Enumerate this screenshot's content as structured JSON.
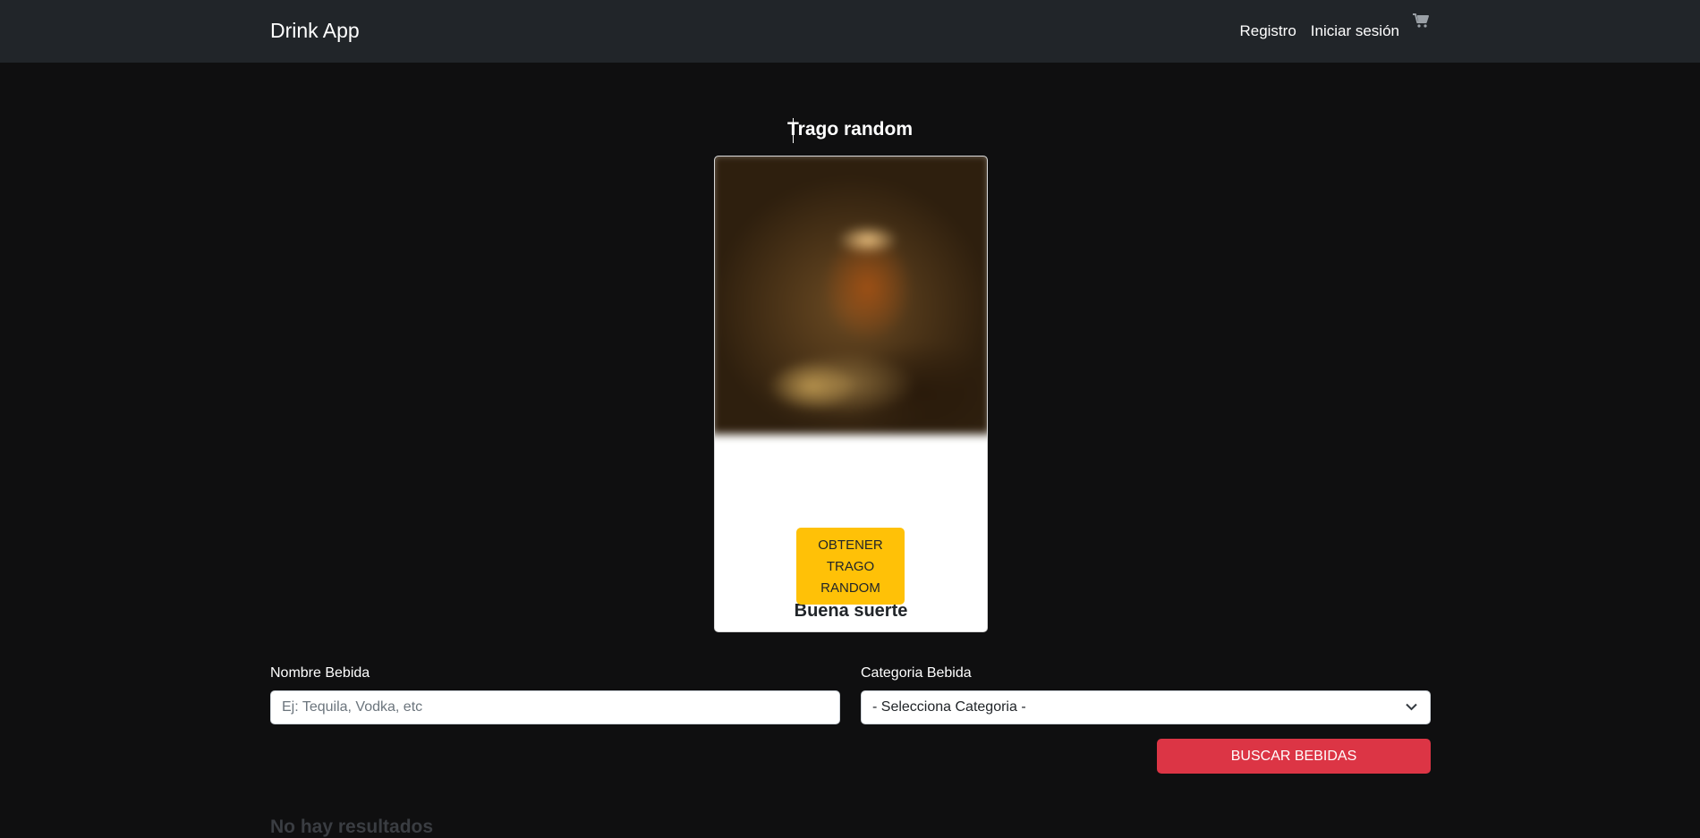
{
  "navbar": {
    "brand": "Drink App",
    "links": [
      "Registro",
      "Iniciar sesión"
    ],
    "cart_icon": "cart-icon"
  },
  "random": {
    "title": "Trago random",
    "card_title": "Buena suerte",
    "button_label": "OBTENER TRAGO RANDOM"
  },
  "form": {
    "name_label": "Nombre Bebida",
    "name_placeholder": "Ej: Tequila, Vodka, etc",
    "category_label": "Categoria Bebida",
    "category_selected": "- Selecciona Categoria -",
    "search_button": "BUSCAR BEBIDAS"
  },
  "results": {
    "empty_text": "No hay resultados"
  },
  "colors": {
    "navbar": "#212529",
    "background": "#0f0f10",
    "warning": "#ffc107",
    "danger": "#dc3545"
  }
}
